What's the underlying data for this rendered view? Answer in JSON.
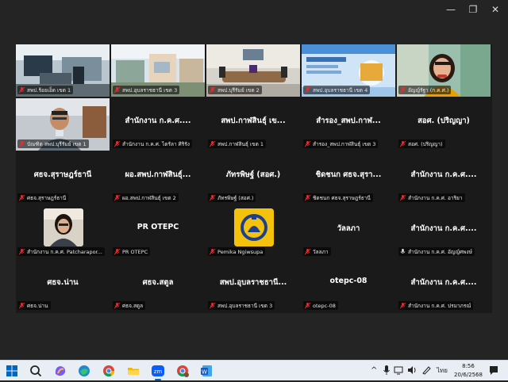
{
  "window": {
    "controls": {
      "minimize": "—",
      "restore": "❐",
      "close": "✕"
    }
  },
  "tiles": [
    {
      "kind": "video",
      "label": "สพป.ร้อยเอ็ด เขต 1",
      "muted": true,
      "scene": "office"
    },
    {
      "kind": "video",
      "label": "สพป.อุบลราชธานี เขต 3",
      "muted": true,
      "scene": "outdoor"
    },
    {
      "kind": "video",
      "label": "สพป.บุรีรัมย์ เขต 2",
      "muted": true,
      "scene": "meeting"
    },
    {
      "kind": "video",
      "label": "สพป.อุบลราชธานี เขต 4",
      "muted": true,
      "scene": "slide"
    },
    {
      "kind": "video",
      "label": "อัญญ์รัฐา (ก.ค.ศ.)",
      "muted": true,
      "scene": "speaker",
      "active": true
    },
    {
      "kind": "video",
      "label": "บัณฑิต สพป.บุรีรัมย์ เขต 1",
      "muted": true,
      "scene": "man"
    },
    {
      "kind": "name",
      "name": "สำนักงาน ก.ค.ศ....",
      "label": "สำนักงาน ก.ค.ศ. ไตรัลา ศิริรัง",
      "muted": true
    },
    {
      "kind": "name",
      "name": "สพป.กาฬสินธุ์ เข...",
      "label": "สพป.กาฬสินธุ์ เขต 1",
      "muted": true
    },
    {
      "kind": "name",
      "name": "สำรอง_สพป.กาฬ...",
      "label": "สำรอง_สพป.กาฬสินธุ์ เขต 3",
      "muted": true
    },
    {
      "kind": "name",
      "name": "สอศ. (ปริญญา)",
      "label": "สอศ. (ปริญญา)",
      "muted": true
    },
    {
      "kind": "name",
      "name": "ศธจ.สุราษฎร์ธานี",
      "label": "ศธจ.สุราษฎร์ธานี",
      "muted": true
    },
    {
      "kind": "name",
      "name": "ผอ.สพป.กาฬสินธุ์...",
      "label": "ผอ.สพป.กาฬสินธุ์ เขต 2",
      "muted": true
    },
    {
      "kind": "name",
      "name": "ภัทรพิษฐ์ (สอศ.)",
      "label": "ภัทรพิษฐ์ (สอศ.)",
      "muted": true
    },
    {
      "kind": "name",
      "name": "ชิดชนก ศธจ.สุรา...",
      "label": "ชิดชนก ศธจ.สุราษฎร์ธานี",
      "muted": true
    },
    {
      "kind": "name",
      "name": "สำนักงาน ก.ค.ศ....",
      "label": "สำนักงาน ก.ค.ศ. อาริยา",
      "muted": true
    },
    {
      "kind": "photo",
      "label": "สำนักงาน ก.ค.ศ. Patcharapor...",
      "muted": true
    },
    {
      "kind": "name",
      "name": "PR OTEPC",
      "label": "PR OTEPC",
      "muted": true
    },
    {
      "kind": "logo",
      "label": "Pemika Ngiwsupa",
      "muted": true
    },
    {
      "kind": "name",
      "name": "วัลลภา",
      "label": "วัลลภา",
      "muted": true
    },
    {
      "kind": "name",
      "name": "สำนักงาน ก.ค.ศ....",
      "label": "สำนักงาน ก.ค.ศ. อัญญ์ศพงษ์",
      "muted": false
    },
    {
      "kind": "name",
      "name": "ศธจ.น่าน",
      "label": "ศธจ.น่าน",
      "muted": true
    },
    {
      "kind": "name",
      "name": "ศธจ.สตูล",
      "label": "ศธจ.สตูล",
      "muted": true
    },
    {
      "kind": "name",
      "name": "สพป.อุบลราชธานี...",
      "label": "สพป.อุบลราชธานี เขต 3",
      "muted": true
    },
    {
      "kind": "name",
      "name": "otepc-08",
      "label": "otepc-08",
      "muted": true
    },
    {
      "kind": "name",
      "name": "สำนักงาน ก.ค.ศ....",
      "label": "สำนักงาน ก.ค.ศ. ปรมาภรณ์",
      "muted": true
    }
  ],
  "taskbar": {
    "apps": [
      {
        "name": "windows-start-icon",
        "active": false
      },
      {
        "name": "search-icon",
        "active": false
      },
      {
        "name": "copilot-icon",
        "active": false
      },
      {
        "name": "edge-icon",
        "active": false
      },
      {
        "name": "chrome-icon",
        "active": false
      },
      {
        "name": "file-explorer-icon",
        "active": false
      },
      {
        "name": "zoom-icon",
        "active": true,
        "text": "zm"
      },
      {
        "name": "chrome-profile-icon",
        "active": false
      },
      {
        "name": "word-icon",
        "active": false,
        "text": "W"
      }
    ],
    "tray": {
      "chevron": "^",
      "language": "ไทย",
      "time": "8:56",
      "date": "20/6/2568"
    }
  },
  "colors": {
    "background": "#242424",
    "tile": "#1a1a1a",
    "active_border": "#2ecc40",
    "muted_icon": "#e03131",
    "taskbar": "#e9eef4"
  }
}
